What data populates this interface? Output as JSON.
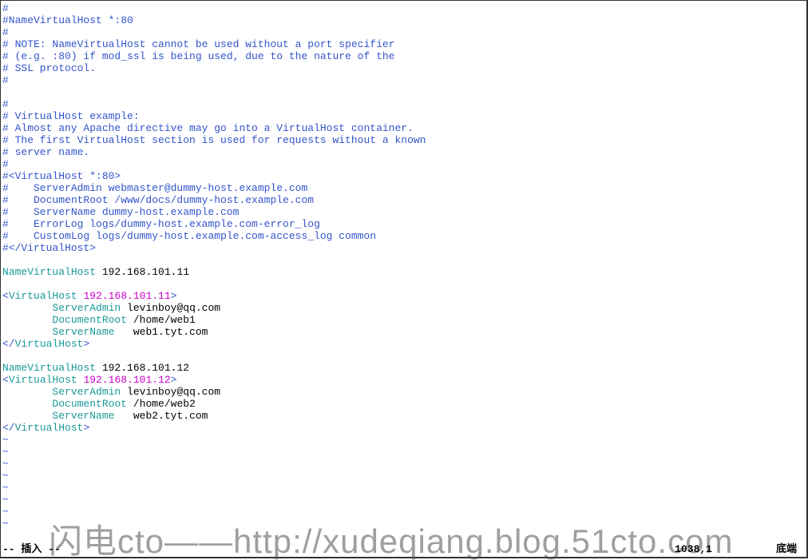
{
  "lines": [
    {
      "type": "comment",
      "text": "#"
    },
    {
      "type": "comment",
      "text": "#NameVirtualHost *:80"
    },
    {
      "type": "comment",
      "text": "#"
    },
    {
      "type": "comment",
      "text": "# NOTE: NameVirtualHost cannot be used without a port specifier"
    },
    {
      "type": "comment",
      "text": "# (e.g. :80) if mod_ssl is being used, due to the nature of the"
    },
    {
      "type": "comment",
      "text": "# SSL protocol."
    },
    {
      "type": "comment",
      "text": "#"
    },
    {
      "type": "blank",
      "text": ""
    },
    {
      "type": "comment",
      "text": "#"
    },
    {
      "type": "comment",
      "text": "# VirtualHost example:"
    },
    {
      "type": "comment",
      "text": "# Almost any Apache directive may go into a VirtualHost container."
    },
    {
      "type": "comment",
      "text": "# The first VirtualHost section is used for requests without a known"
    },
    {
      "type": "comment",
      "text": "# server name."
    },
    {
      "type": "comment",
      "text": "#"
    },
    {
      "type": "comment",
      "text": "#<VirtualHost *:80>"
    },
    {
      "type": "comment",
      "text": "#    ServerAdmin webmaster@dummy-host.example.com"
    },
    {
      "type": "comment",
      "text": "#    DocumentRoot /www/docs/dummy-host.example.com"
    },
    {
      "type": "comment",
      "text": "#    ServerName dummy-host.example.com"
    },
    {
      "type": "comment",
      "text": "#    ErrorLog logs/dummy-host.example.com-error_log"
    },
    {
      "type": "comment",
      "text": "#    CustomLog logs/dummy-host.example.com-access_log common"
    },
    {
      "type": "comment",
      "text": "#</VirtualHost>"
    },
    {
      "type": "blank",
      "text": ""
    },
    {
      "type": "directive",
      "keyword": "NameVirtualHost",
      "value": " 192.168.101.11"
    },
    {
      "type": "blank",
      "text": ""
    },
    {
      "type": "opentag",
      "open": "<",
      "name": "VirtualHost",
      "attrs": " 192.168.101.11",
      "close": ">"
    },
    {
      "type": "indent-directive",
      "indent": "        ",
      "keyword": "ServerAdmin",
      "value": " levinboy@qq.com"
    },
    {
      "type": "indent-directive",
      "indent": "        ",
      "keyword": "DocumentRoot",
      "value": " /home/web1"
    },
    {
      "type": "indent-directive",
      "indent": "        ",
      "keyword": "ServerName",
      "value": "   web1.tyt.com"
    },
    {
      "type": "closetag",
      "open": "</",
      "name": "VirtualHost",
      "close": ">"
    },
    {
      "type": "blank",
      "text": ""
    },
    {
      "type": "directive",
      "keyword": "NameVirtualHost",
      "value": " 192.168.101.12"
    },
    {
      "type": "opentag",
      "open": "<",
      "name": "VirtualHost",
      "attrs": " 192.168.101.12",
      "close": ">"
    },
    {
      "type": "indent-directive",
      "indent": "        ",
      "keyword": "ServerAdmin",
      "value": " levinboy@qq.com"
    },
    {
      "type": "indent-directive",
      "indent": "        ",
      "keyword": "DocumentRoot",
      "value": " /home/web2"
    },
    {
      "type": "indent-directive",
      "indent": "        ",
      "keyword": "ServerName",
      "value": "   web2.tyt.com"
    },
    {
      "type": "closetag",
      "open": "</",
      "name": "VirtualHost",
      "close": ">"
    }
  ],
  "tilde_count": 8,
  "status": {
    "mode": "-- 插入 --",
    "position": "1038,1",
    "scroll": "底端"
  },
  "watermark": "闪电cto——http://xudeqiang.blog.51cto.com"
}
